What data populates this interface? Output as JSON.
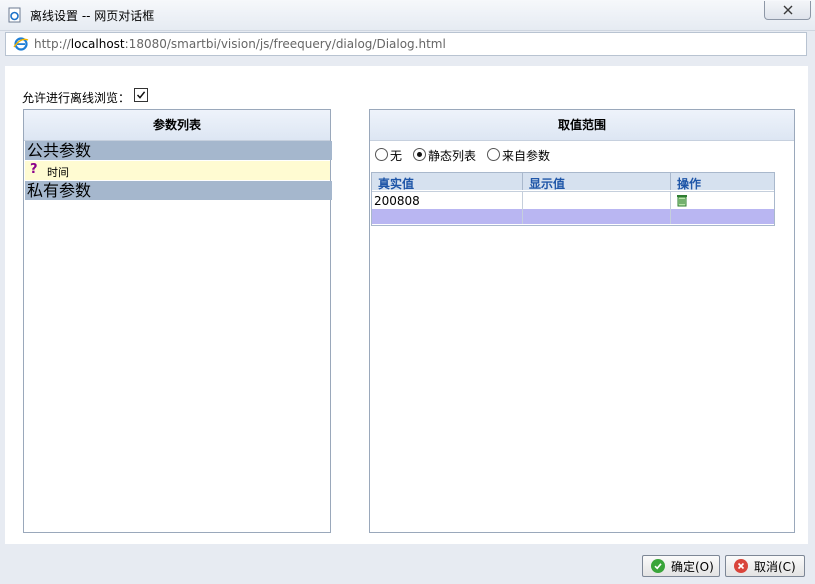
{
  "window": {
    "title": "离线设置 -- 网页对话框",
    "url_prefix": "http://",
    "url_host": "localhost",
    "url_rest": ":18080/smartbi/vision/js/freequery/dialog/Dialog.html"
  },
  "options": {
    "allow_offline_label": "允许进行离线浏览：",
    "allow_offline_checked": true
  },
  "left_panel": {
    "header": "参数列表",
    "groups": [
      {
        "label": "公共参数",
        "items": [
          {
            "label": "时间",
            "icon": "question-icon"
          }
        ]
      },
      {
        "label": "私有参数",
        "items": []
      }
    ]
  },
  "right_panel": {
    "header": "取值范围",
    "radios": [
      {
        "label": "无",
        "checked": false
      },
      {
        "label": "静态列表",
        "checked": true
      },
      {
        "label": "来自参数",
        "checked": false
      }
    ],
    "table": {
      "columns": [
        "真实值",
        "显示值",
        "操作"
      ],
      "rows": [
        {
          "real": "200808",
          "display": "",
          "action_icon": "delete-icon"
        }
      ]
    }
  },
  "buttons": {
    "ok": "确定(O)",
    "cancel": "取消(C)"
  },
  "colors": {
    "group_bg": "#a5b7cd",
    "param_bg": "#fffbd2",
    "header_text": "#1f56a8",
    "new_row_bg": "#b9b6f2"
  }
}
